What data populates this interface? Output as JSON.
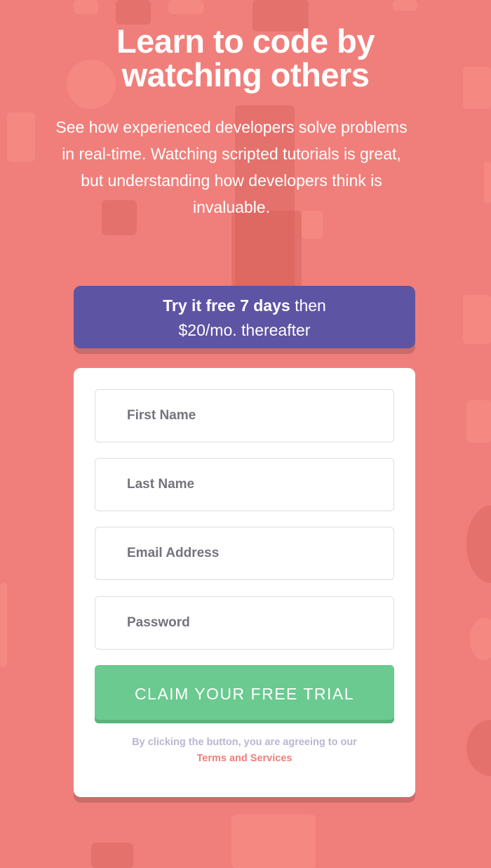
{
  "hero": {
    "title_line1": "Learn to code by",
    "title_line2": "watching others",
    "subtitle": "See how experienced developers solve problems in real-time. Watching scripted tutorials is great, but understanding how developers think is invaluable."
  },
  "promo": {
    "bold_text": "Try it free 7 days",
    "tail_text": " then",
    "line2": "$20/mo. thereafter"
  },
  "form": {
    "first_name": {
      "placeholder": "First Name",
      "value": ""
    },
    "last_name": {
      "placeholder": "Last Name",
      "value": ""
    },
    "email": {
      "placeholder": "Email Address",
      "value": ""
    },
    "password": {
      "placeholder": "Password",
      "value": ""
    },
    "submit_label": "CLAIM YOUR FREE TRIAL"
  },
  "terms": {
    "text": "By clicking the button, you are agreeing to our",
    "link_label": "Terms and Services"
  },
  "colors": {
    "background": "#F07F7B",
    "banner": "#5E54A4",
    "button": "#6ACA8F",
    "terms_text": "#B9B6D3",
    "link": "#F07F7B"
  }
}
